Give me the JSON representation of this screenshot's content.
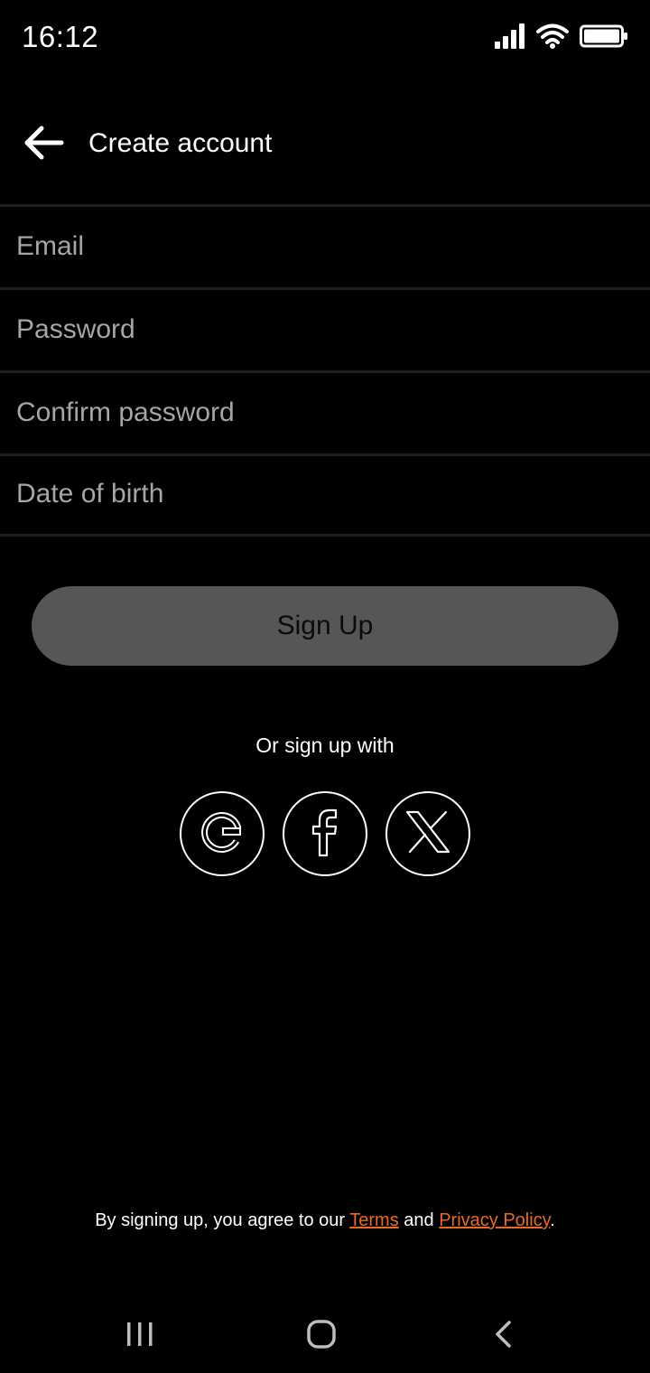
{
  "status_bar": {
    "time": "16:12",
    "icons": [
      "signal-icon",
      "wifi-icon",
      "battery-icon"
    ]
  },
  "header": {
    "back_icon": "arrow-left-icon",
    "title": "Create account"
  },
  "form": {
    "email_placeholder": "Email",
    "email_value": "",
    "password_placeholder": "Password",
    "password_value": "",
    "confirm_placeholder": "Confirm password",
    "confirm_value": "",
    "dob_placeholder": "Date of birth",
    "dob_value": ""
  },
  "signup_label": "Sign Up",
  "social": {
    "label": "Or sign up with",
    "providers": [
      "google-icon",
      "facebook-icon",
      "x-icon"
    ]
  },
  "legal": {
    "prefix": "By signing up, you agree to our ",
    "terms": "Terms",
    "middle": " and ",
    "privacy": "Privacy Policy",
    "suffix": "."
  },
  "nav": {
    "icons": [
      "recent-apps-icon",
      "home-icon",
      "back-icon"
    ]
  },
  "colors": {
    "background": "#000000",
    "button": "#565656",
    "link": "#e86a28",
    "placeholder": "#a6a6a6"
  }
}
